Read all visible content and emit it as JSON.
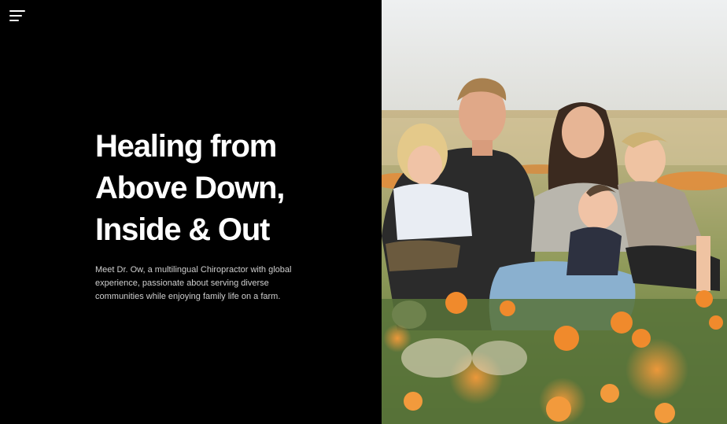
{
  "menu": {
    "icon": "hamburger-menu-icon"
  },
  "hero": {
    "headline_line_1": "Healing from",
    "headline_line_2": "Above Down,",
    "headline_line_3": "Inside & Out",
    "description": "Meet Dr. Ow, a multilingual Chiropractor with global experience, passionate about serving diverse communities while enjoying family life on a farm."
  },
  "colors": {
    "background": "#000000",
    "headline": "#ffffff",
    "body_text": "#cfcfcf",
    "flowers": "#f08a2c"
  }
}
